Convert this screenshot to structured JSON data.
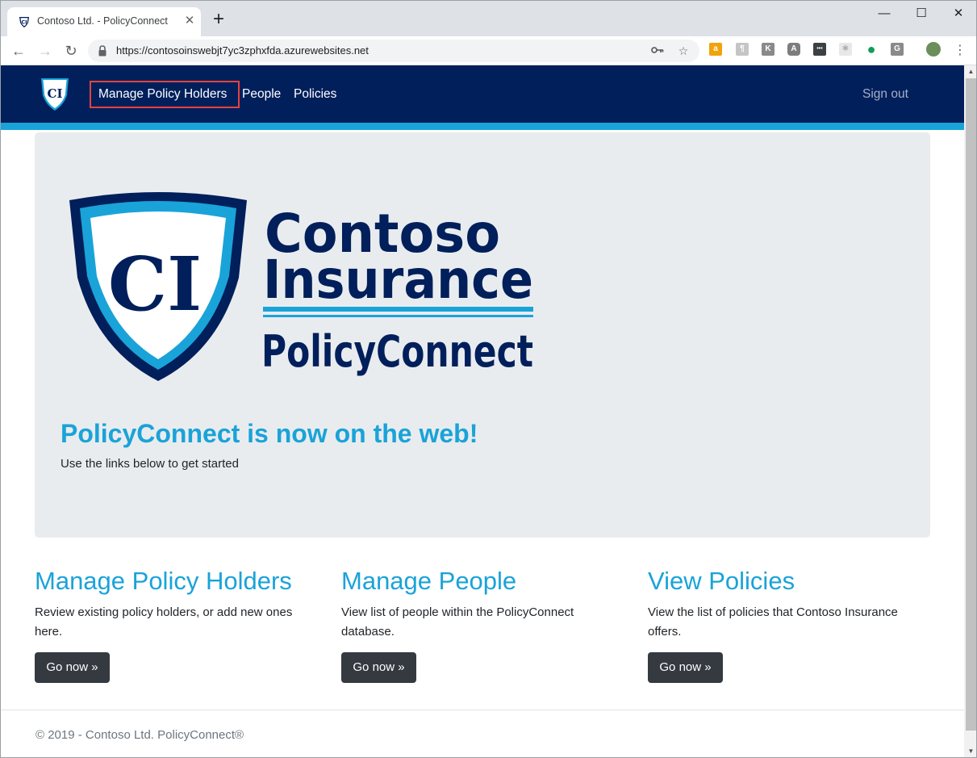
{
  "browser": {
    "tab_title": "Contoso Ltd. - PolicyConnect",
    "tab_close": "✕",
    "new_tab": "+",
    "url": "https://contosoinswebjt7yc3zphxfda.azurewebsites.net",
    "window_controls": {
      "minimize": "—",
      "maximize": "☐",
      "close": "✕"
    },
    "nav": {
      "back": "←",
      "forward": "→",
      "reload": "↻"
    },
    "omnibox_icons": [
      "key-icon",
      "star-icon"
    ],
    "extensions": [
      {
        "name": "amazon-extension-icon",
        "glyph": "a",
        "color": "#f0a30a"
      },
      {
        "name": "translate-extension-icon",
        "glyph": "¶",
        "color": "#c5c5c5"
      },
      {
        "name": "k-extension-icon",
        "glyph": "K",
        "color": "#8a8a8a"
      },
      {
        "name": "angular-extension-icon",
        "glyph": "A",
        "color": "#7d7d7d"
      },
      {
        "name": "more-dots-extension-icon",
        "glyph": "•••",
        "color": "#3c4043"
      },
      {
        "name": "react-extension-icon",
        "glyph": "✱",
        "color": "#d8d8d8"
      },
      {
        "name": "green-extension-icon",
        "glyph": "●",
        "color": "#0f9d58"
      },
      {
        "name": "g-extension-icon",
        "glyph": "G",
        "color": "#8a8a8a"
      }
    ],
    "menu": "⋮"
  },
  "navbar": {
    "logo_text": "CI",
    "links": [
      "Manage Policy Holders",
      "People",
      "Policies"
    ],
    "signout": "Sign out",
    "colors": {
      "background": "#001f5b",
      "accent": "#1aa3d8",
      "highlight": "#e5433d"
    }
  },
  "hero": {
    "logo_lines": [
      "Contoso",
      "Insurance",
      "PolicyConnect"
    ],
    "logo_monogram": "CI",
    "heading": "PolicyConnect is now on the web!",
    "subheading": "Use the links below to get started"
  },
  "columns": [
    {
      "title": "Manage Policy Holders",
      "text": "Review existing policy holders, or add new ones here.",
      "button": "Go now »"
    },
    {
      "title": "Manage People",
      "text": "View list of people within the PolicyConnect database.",
      "button": "Go now »"
    },
    {
      "title": "View Policies",
      "text": "View the list of policies that Contoso Insurance offers.",
      "button": "Go now »"
    }
  ],
  "footer": "© 2019 - Contoso Ltd. PolicyConnect®"
}
